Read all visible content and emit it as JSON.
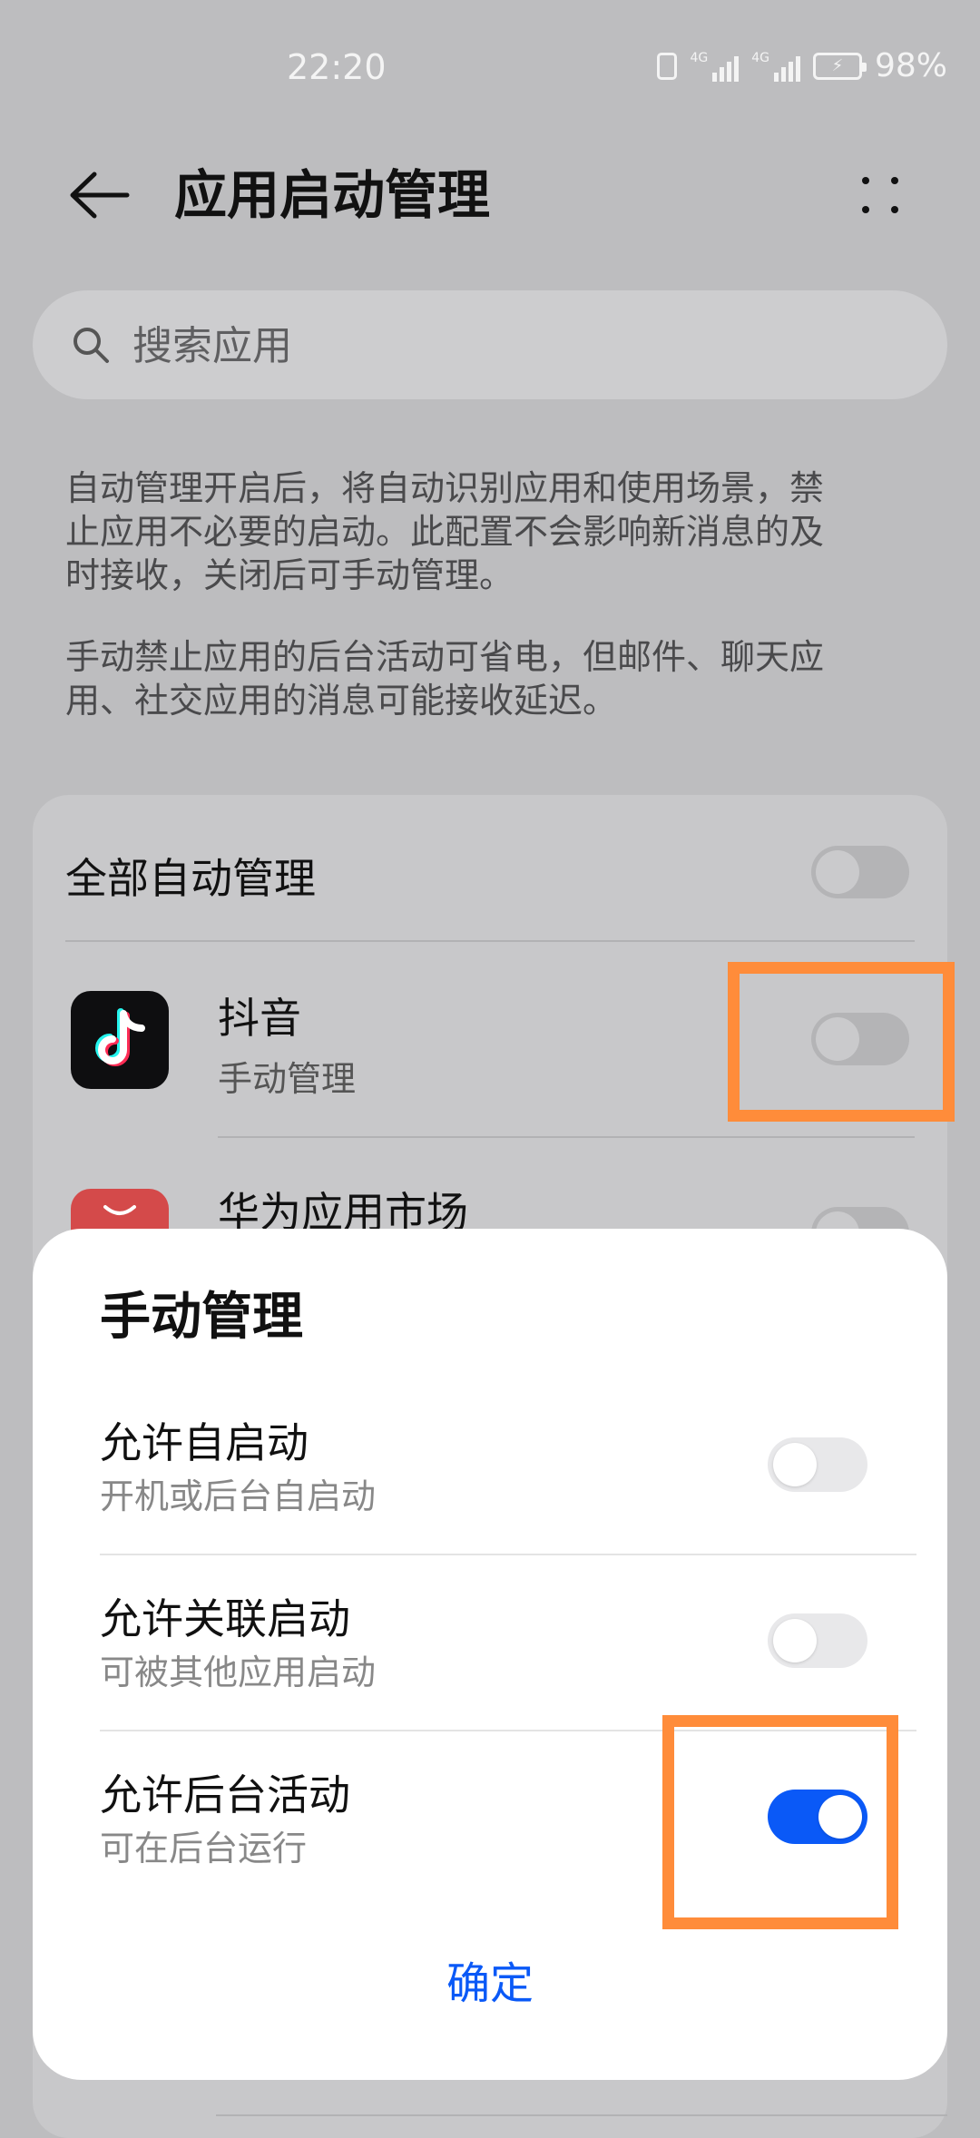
{
  "status_bar": {
    "time": "22:20",
    "battery": "98%",
    "net1": "4G",
    "net2": "4G"
  },
  "header": {
    "title": "应用启动管理"
  },
  "search": {
    "placeholder": "搜索应用"
  },
  "description": {
    "para1_line1": "自动管理开启后，将自动识别应用和使用场景，禁",
    "para1_line2": "止应用不必要的启动。此配置不会影响新消息的及",
    "para1_line3": "时接收，关闭后可手动管理。",
    "para2_line1": "手动禁止应用的后台活动可省电，但邮件、聊天应",
    "para2_line2": "用、社交应用的消息可能接收延迟。"
  },
  "list": {
    "all_auto_label": "全部自动管理",
    "all_auto_on": false,
    "apps": [
      {
        "name": "抖音",
        "status": "手动管理",
        "auto_managed": false,
        "icon": "tiktok-icon"
      },
      {
        "name": "华为应用市场",
        "status": "",
        "auto_managed": false,
        "icon": "huawei-appgallery-icon"
      }
    ]
  },
  "sheet": {
    "title": "手动管理",
    "options": [
      {
        "title": "允许自启动",
        "subtitle": "开机或后台自启动",
        "enabled": false
      },
      {
        "title": "允许关联启动",
        "subtitle": "可被其他应用启动",
        "enabled": false
      },
      {
        "title": "允许后台活动",
        "subtitle": "可在后台运行",
        "enabled": true
      }
    ],
    "confirm_label": "确定"
  },
  "colors": {
    "accent": "#0a59f7",
    "highlight": "#ff8c3a",
    "dim_background": "#bdbdbf"
  }
}
